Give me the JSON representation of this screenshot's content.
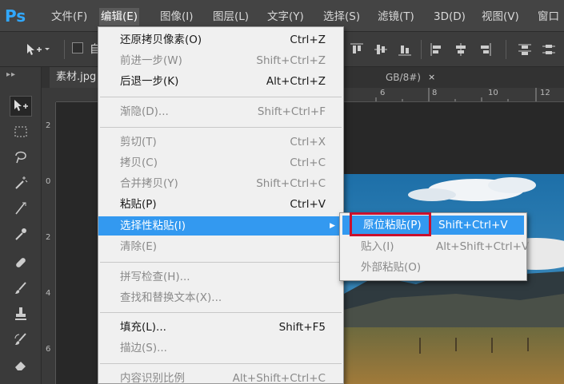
{
  "app": {
    "logo": "Ps",
    "accent": "#31a8ff"
  },
  "menubar": {
    "items": [
      "文件(F)",
      "编辑(E)",
      "图像(I)",
      "图层(L)",
      "文字(Y)",
      "选择(S)",
      "滤镜(T)",
      "3D(D)",
      "视图(V)",
      "窗口"
    ],
    "active_index": 1
  },
  "options_bar": {
    "checkbox_label": "自"
  },
  "document": {
    "tab_name": "素材.jpg",
    "tab_suffix": "GB/8#)",
    "close_glyph": "×",
    "ruler_top_labels": [
      "6",
      "8",
      "10",
      "12"
    ],
    "ruler_left_labels": [
      "2",
      "0",
      "2",
      "4",
      "6"
    ]
  },
  "edit_menu": {
    "items": [
      {
        "label": "还原拷贝像素(O)",
        "shortcut": "Ctrl+Z",
        "disabled": false
      },
      {
        "label": "前进一步(W)",
        "shortcut": "Shift+Ctrl+Z",
        "disabled": true
      },
      {
        "label": "后退一步(K)",
        "shortcut": "Alt+Ctrl+Z",
        "disabled": false
      },
      {
        "label": "渐隐(D)...",
        "shortcut": "Shift+Ctrl+F",
        "disabled": true
      },
      {
        "label": "剪切(T)",
        "shortcut": "Ctrl+X",
        "disabled": true
      },
      {
        "label": "拷贝(C)",
        "shortcut": "Ctrl+C",
        "disabled": true
      },
      {
        "label": "合并拷贝(Y)",
        "shortcut": "Shift+Ctrl+C",
        "disabled": true
      },
      {
        "label": "粘贴(P)",
        "shortcut": "Ctrl+V",
        "disabled": false
      },
      {
        "label": "选择性粘贴(I)",
        "shortcut": "",
        "disabled": false,
        "highlight": true,
        "submenu_arrow": "▶"
      },
      {
        "label": "清除(E)",
        "shortcut": "",
        "disabled": true
      },
      {
        "label": "拼写检查(H)...",
        "shortcut": "",
        "disabled": true
      },
      {
        "label": "查找和替换文本(X)...",
        "shortcut": "",
        "disabled": true
      },
      {
        "label": "填充(L)...",
        "shortcut": "Shift+F5",
        "disabled": false
      },
      {
        "label": "描边(S)...",
        "shortcut": "",
        "disabled": true
      },
      {
        "label": "内容识别比例",
        "shortcut": "Alt+Shift+Ctrl+C",
        "disabled": true
      }
    ]
  },
  "paste_special_menu": {
    "items": [
      {
        "label": "原位粘贴(P)",
        "shortcut": "Shift+Ctrl+V",
        "disabled": false,
        "highlight": true
      },
      {
        "label": "贴入(I)",
        "shortcut": "Alt+Shift+Ctrl+V",
        "disabled": true
      },
      {
        "label": "外部粘贴(O)",
        "shortcut": "",
        "disabled": true
      }
    ],
    "callout_color": "#c8102e"
  }
}
